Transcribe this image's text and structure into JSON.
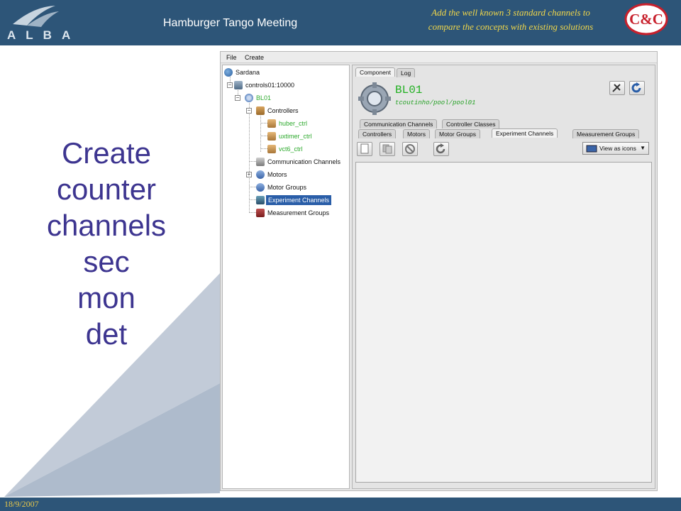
{
  "slide": {
    "logo_text": "ALBA",
    "meeting_title": "Hamburger Tango Meeting",
    "note_line1": "Add the well known 3 standard channels to",
    "note_line2": "compare the concepts with existing solutions",
    "cc_logo_text": "C&C",
    "date": "18/9/2007",
    "callout_lines": [
      "Create",
      "counter",
      "channels",
      "sec",
      "mon",
      "det"
    ]
  },
  "colors": {
    "header_bar": "#2d5578",
    "callout_text": "#3d3590",
    "note_text": "#f0d64a",
    "pool_green": "#22b022",
    "selection": "#2a5ea8"
  },
  "app": {
    "menu": [
      "File",
      "Create"
    ],
    "tree": {
      "root": "Sardana",
      "server": "controls01:10000",
      "pool": "BL01",
      "controllers_folder": "Controllers",
      "controllers": [
        "huber_ctrl",
        "uxtimer_ctrl",
        "vct6_ctrl"
      ],
      "communication_channels": "Communication Channels",
      "motors": "Motors",
      "motor_groups": "Motor Groups",
      "experiment_channels": "Experiment Channels",
      "measurement_groups": "Measurement Groups",
      "selected": "Experiment Channels"
    },
    "top_tabs": [
      "Component",
      "Log"
    ],
    "pool_header": {
      "name": "BL01",
      "path": "tcoutinho/pool/pool01"
    },
    "tabs_row1": [
      "Communication Channels",
      "Controller Classes"
    ],
    "tabs_row2": [
      "Controllers",
      "Motors",
      "Motor Groups",
      "Experiment Channels",
      "Measurement Groups"
    ],
    "active_tab": "Experiment Channels",
    "view_select": "View as icons",
    "icons": {
      "settings": "wrench-screwdriver-icon",
      "refresh": "refresh-icon",
      "new": "new-document-icon",
      "copy": "copy-icon",
      "delete": "delete-icon",
      "reload": "reload-icon"
    }
  }
}
